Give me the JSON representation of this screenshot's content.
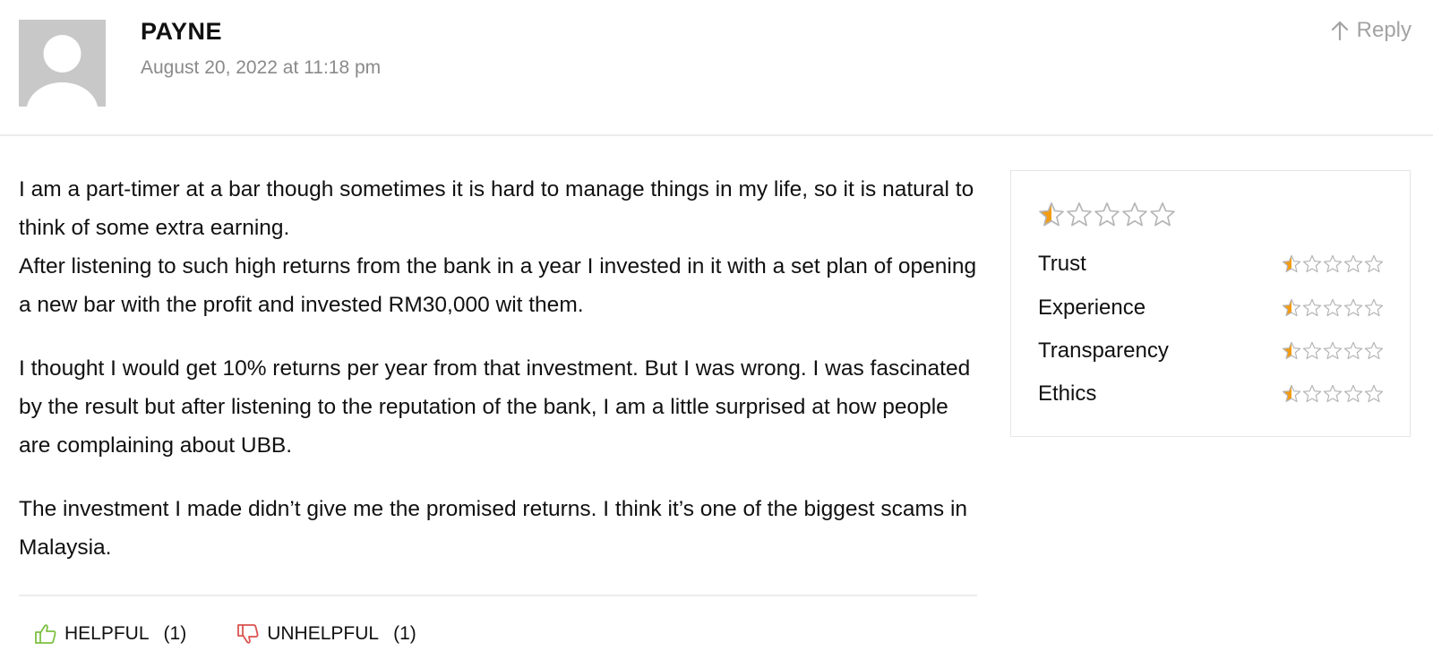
{
  "comment": {
    "author": "PAYNE",
    "date": "August 20, 2022 at 11:18 pm",
    "reply_label": "Reply",
    "paragraphs": [
      "I am a part-timer at a bar though sometimes it is hard to manage things in my life, so it is natural to think of some extra earning.\nAfter listening to such high returns from the bank in a year I invested in it with a set plan of opening a new bar with the profit and invested RM30,000 wit them.",
      "I thought I would get 10% returns per year from that investment. But I was wrong. I was fascinated by the result but after listening to the reputation of the bank, I am a little surprised at how people are complaining about UBB.",
      "The investment I made didn’t give me the promised returns. I think it’s one of the biggest scams in Malaysia."
    ]
  },
  "rating": {
    "overall": 0.5,
    "max": 5,
    "criteria": [
      {
        "label": "Trust",
        "value": 0.5
      },
      {
        "label": "Experience",
        "value": 0.5
      },
      {
        "label": "Transparency",
        "value": 0.5
      },
      {
        "label": "Ethics",
        "value": 0.5
      }
    ]
  },
  "votes": {
    "helpful_label": "HELPFUL",
    "helpful_count": "(1)",
    "unhelpful_label": "UNHELPFUL",
    "unhelpful_count": "(1)"
  },
  "colors": {
    "star_fill": "#f39c12",
    "star_empty": "#b5b5b5",
    "helpful_icon": "#7cc142",
    "unhelpful_icon": "#d9534f"
  }
}
